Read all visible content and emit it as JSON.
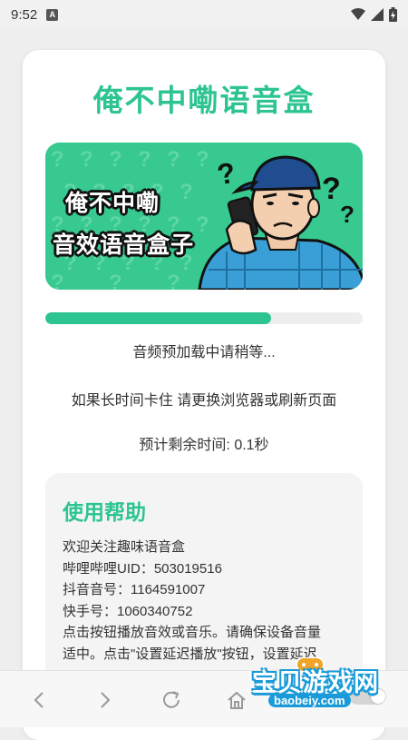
{
  "status_bar": {
    "time": "9:52",
    "app_badge": "A",
    "icons": [
      "wifi-icon",
      "signal-icon",
      "battery-charging-icon"
    ]
  },
  "page": {
    "title": "俺不中嘞语音盒",
    "banner": {
      "line1": "俺不中嘞",
      "line2": "音效语音盒子",
      "colors": {
        "background": "#37c98f",
        "question_marks": "#5fd6a6"
      }
    },
    "progress": {
      "value": 0.71,
      "color": "#2ec492"
    },
    "loading_text": "音频预加载中请稍等...",
    "hint_text": "如果长时间卡住 请更换浏览器或刷新页面",
    "eta_text": "预计剩余时间: 0.1秒"
  },
  "help": {
    "title": "使用帮助",
    "lines": [
      "欢迎关注趣味语音盒",
      "哔哩哔哩UID：503019516",
      "抖音音号：1164591007",
      "快手号：1060340752",
      "点击按钮播放音效或音乐。请确保设备音量",
      "适中。点击\"设置延迟播放\"按钮，设置延迟"
    ]
  },
  "bottom_nav": {
    "buttons": [
      "back-icon",
      "forward-icon",
      "refresh-icon",
      "home-icon"
    ]
  },
  "watermark": {
    "text": "宝贝游戏网",
    "url": "baobeiy.com"
  },
  "colors": {
    "accent": "#2ec492",
    "card": "#ffffff",
    "help_bg": "#f3f4f3"
  }
}
